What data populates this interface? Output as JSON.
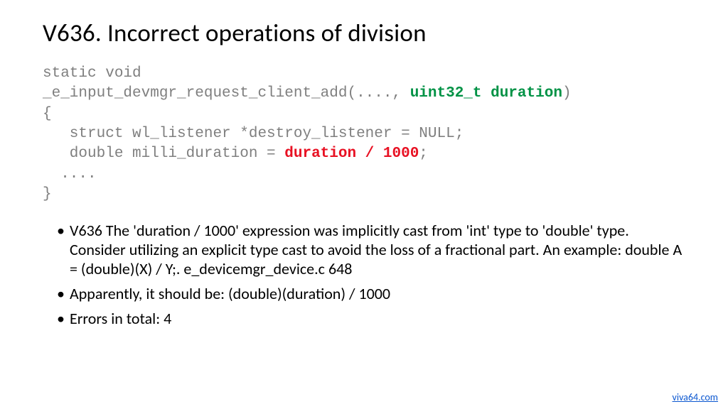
{
  "title": "V636. Incorrect operations of division",
  "code": {
    "l1": "static void",
    "l2a": "_e_input_devmgr_request_client_add(...., ",
    "l2b": "uint32_t duration",
    "l2c": ")",
    "l3": "{",
    "l4": "   struct wl_listener *destroy_listener = NULL;",
    "l5a": "   double milli_duration = ",
    "l5b": "duration / 1000",
    "l5c": ";",
    "l6": "  ....",
    "l7": "}"
  },
  "bullets": {
    "b1": "V636 The 'duration / 1000' expression was implicitly cast from 'int' type to 'double' type. Consider utilizing an explicit type cast to avoid the loss of a fractional part. An example: double A = (double)(X) / Y;. e_devicemgr_device.c 648",
    "b2": "Apparently, it should be: (double)(duration) / 1000",
    "b3": "Errors in total: 4"
  },
  "footer": {
    "link_text": "viva64.com"
  }
}
